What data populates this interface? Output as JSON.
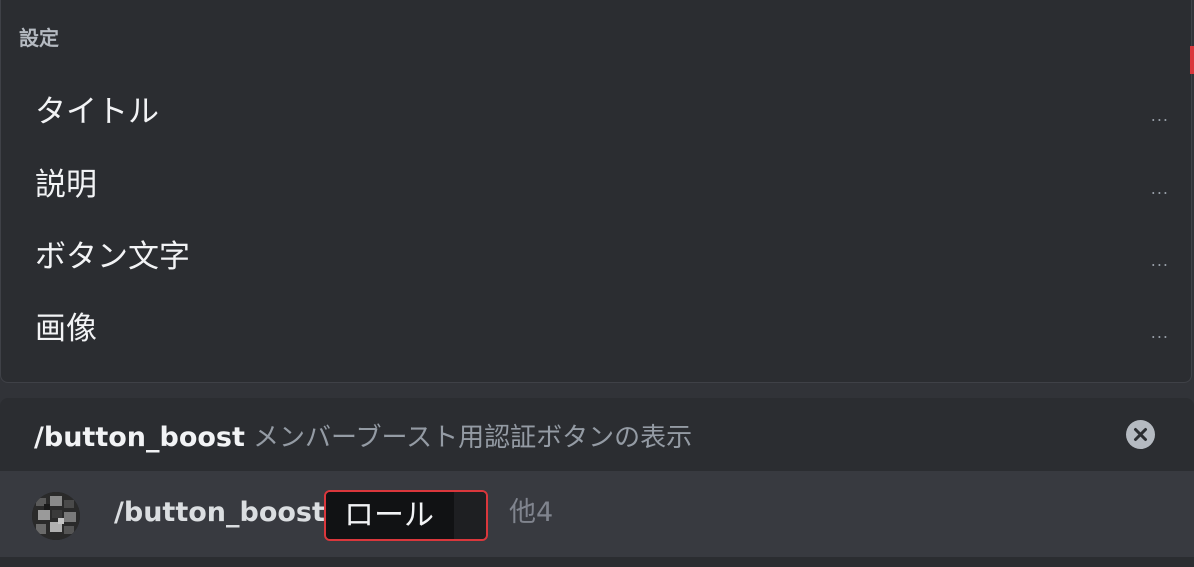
{
  "options": {
    "section_title": "設定",
    "items": [
      {
        "label": "タイトル",
        "more": "..."
      },
      {
        "label": "説明",
        "more": "..."
      },
      {
        "label": "ボタン文字",
        "more": "..."
      },
      {
        "label": "画像",
        "more": "..."
      }
    ]
  },
  "command": {
    "name": "/button_boost",
    "description": "メンバーブースト用認証ボタンの表示",
    "close_icon": "close-circle-icon"
  },
  "input": {
    "avatar_icon": "bot-avatar-icon",
    "command_text": "/button_boost",
    "param_label": "ロール",
    "more_params": "他4"
  },
  "colors": {
    "background": "#313338",
    "popup": "#2b2d31",
    "input_bar": "#383a40",
    "param_border": "#da373c",
    "muted_text": "#949ba4"
  }
}
